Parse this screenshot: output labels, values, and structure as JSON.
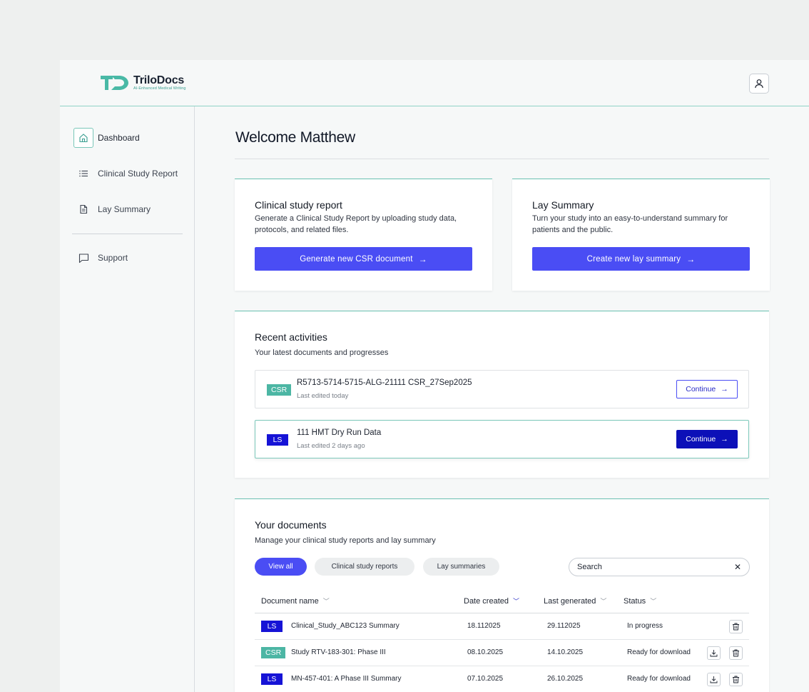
{
  "header": {
    "brand_name": "TriloDocs",
    "brand_tagline": "AI-Enhanced Medical Writing"
  },
  "sidebar": {
    "items": [
      {
        "label": "Dashboard",
        "icon": "home-icon",
        "active": true
      },
      {
        "label": "Clinical Study Report",
        "icon": "list-icon"
      },
      {
        "label": "Lay Summary",
        "icon": "document-icon"
      },
      {
        "label": "Support",
        "icon": "chat-icon"
      }
    ]
  },
  "main": {
    "welcome": "Welcome Matthew",
    "csr_card": {
      "title": "Clinical study report",
      "description_line1": "Generate a Clinical Study Report by uploading study data,",
      "description_line2": "protocols, and related files.",
      "button": "Generate new CSR document"
    },
    "lay_card": {
      "title": "Lay Summary",
      "description_line1": "Turn your study into an easy-to-understand summary for",
      "description_line2": "patients and the public.",
      "button": "Create new lay summary"
    },
    "recent": {
      "title": "Recent activities",
      "subtitle": "Your latest documents and progresses",
      "items": [
        {
          "badge": "CSR",
          "title": "R5713-5714-5715-ALG-21111 CSR_27Sep2025",
          "subtitle": "Last edited today",
          "button": "Continue"
        },
        {
          "badge": "LS",
          "title": "111 HMT Dry Run Data",
          "subtitle": "Last edited 2 days ago",
          "button": "Continue"
        }
      ]
    },
    "documents": {
      "title": "Your documents",
      "subtitle": "Manage your clinical study reports and lay summary",
      "filters": [
        "View all",
        "Clinical study reports",
        "Lay summaries"
      ],
      "search_placeholder": "Search",
      "columns": [
        "Document name",
        "Date created",
        "Last generated",
        "Status"
      ],
      "rows": [
        {
          "badge": "LS",
          "name": "Clinical_Study_ABC123 Summary",
          "created": "18.112025",
          "generated": "29.112025",
          "status": "In progress",
          "download": false
        },
        {
          "badge": "CSR",
          "name": "Study RTV-183-301: Phase III",
          "created": "08.10.2025",
          "generated": "14.10.2025",
          "status": "Ready for download",
          "download": true
        },
        {
          "badge": "LS",
          "name": "MN-457-401: A Phase III Summary",
          "created": "07.10.2025",
          "generated": "26.10.2025",
          "status": "Ready for download",
          "download": true
        }
      ]
    }
  },
  "colors": {
    "accent": "#4a4df4",
    "teal": "#4cb6a4",
    "ls_badge": "#1613d6",
    "dark_button": "#0c10b8"
  }
}
